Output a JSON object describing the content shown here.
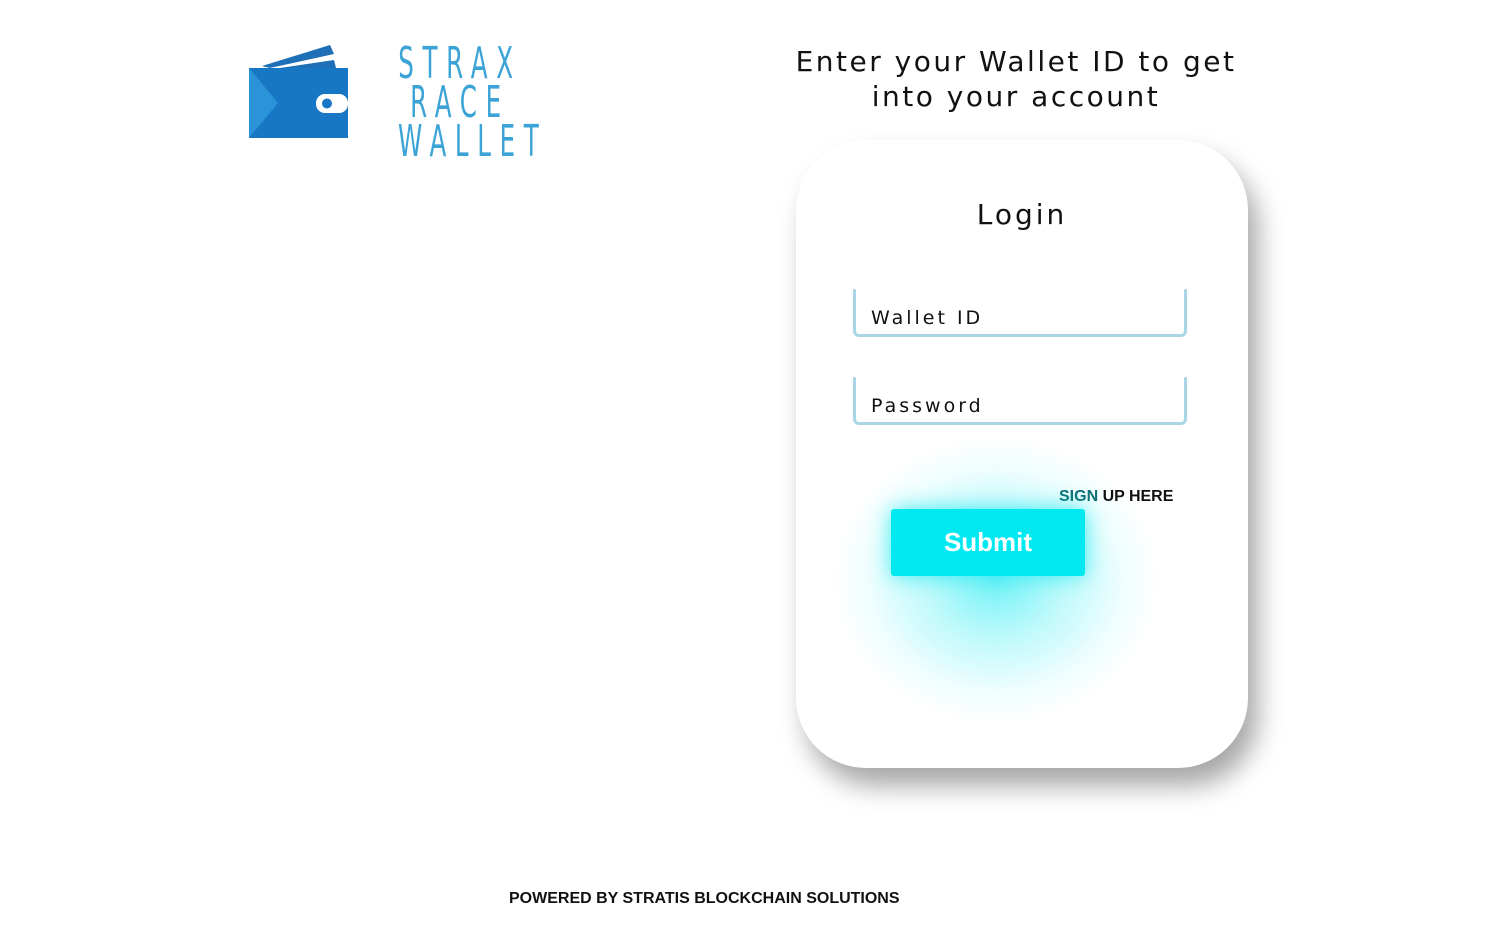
{
  "brand": {
    "logo_lines": [
      "STRAX",
      "RACE",
      "WALLET"
    ],
    "logo_color": "#3ba3d6",
    "icon": "wallet-icon"
  },
  "header": {
    "line1": "Enter your Wallet ID to get",
    "line2": "into your account"
  },
  "login_card": {
    "title": "Login",
    "wallet_id_placeholder": "Wallet ID",
    "password_placeholder": "Password",
    "signup_prefix": "SIGN",
    "signup_rest": " UP HERE",
    "submit_label": "Submit",
    "accent_color": "#00e8f0",
    "field_border_color": "#a9d6e5"
  },
  "footer": {
    "text": "POWERED BY STRATIS BLOCKCHAIN SOLUTIONS"
  }
}
